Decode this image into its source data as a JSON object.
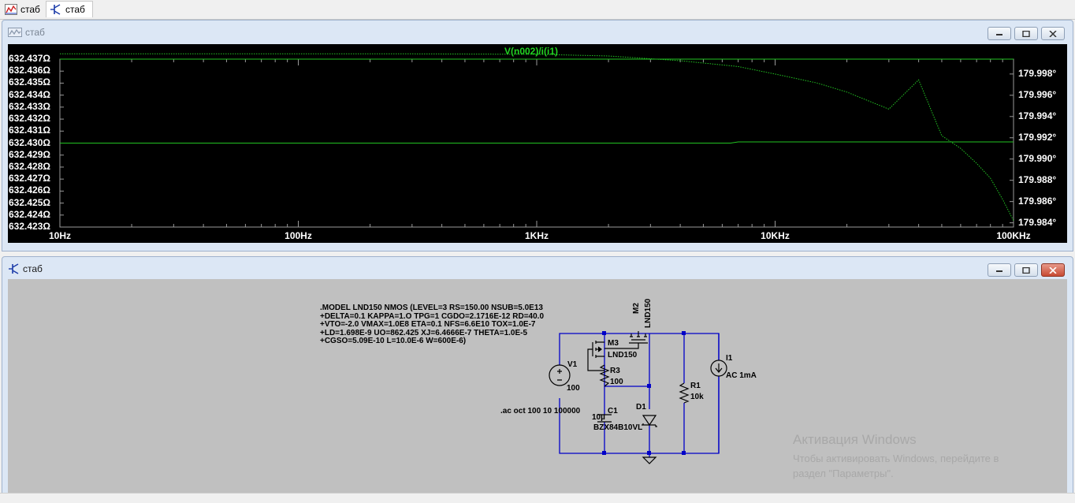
{
  "tabs": [
    {
      "label": "стаб",
      "icon": "waveform-icon"
    },
    {
      "label": "стаб",
      "icon": "schematic-icon"
    }
  ],
  "plot_window": {
    "title": "стаб"
  },
  "schematic_window": {
    "title": "стаб"
  },
  "chart_data": {
    "type": "line",
    "title": "V(n002)/i(i1)",
    "x_scale": "log",
    "xlim": [
      10,
      100000
    ],
    "x_ticks": [
      "10Hz",
      "100Hz",
      "1KHz",
      "10KHz",
      "100KHz"
    ],
    "left_ticks": [
      "632.437Ω",
      "632.436Ω",
      "632.435Ω",
      "632.434Ω",
      "632.433Ω",
      "632.432Ω",
      "632.431Ω",
      "632.430Ω",
      "632.429Ω",
      "632.428Ω",
      "632.427Ω",
      "632.426Ω",
      "632.425Ω",
      "632.424Ω",
      "632.423Ω"
    ],
    "left_ylim": [
      632.423,
      632.437
    ],
    "right_ticks": [
      "179.998°",
      "179.996°",
      "179.994°",
      "179.992°",
      "179.990°",
      "179.988°",
      "179.986°",
      "179.984°"
    ],
    "right_ylim": [
      179.9836,
      179.9994
    ],
    "grid": false,
    "series": [
      {
        "role": "magnitude",
        "axis": "left",
        "color": "#22c322",
        "x": [
          10,
          100,
          1000,
          10000,
          100000
        ],
        "y": [
          632.437,
          632.437,
          632.437,
          632.437,
          632.437
        ]
      },
      {
        "role": "magnitude-flat",
        "axis": "left",
        "color": "#22c322",
        "x": [
          10,
          100,
          1000,
          6500,
          7000,
          100000
        ],
        "y": [
          632.43,
          632.43,
          632.43,
          632.43,
          632.4301,
          632.4301
        ]
      },
      {
        "role": "phase",
        "axis": "right",
        "color": "#22c322",
        "dotted": true,
        "x": [
          10,
          300,
          1000,
          2000,
          4000,
          7000,
          10000,
          15000,
          20000,
          30000,
          40000,
          50000,
          60000,
          70000,
          80000,
          90000,
          100000
        ],
        "y": [
          179.9999,
          179.9999,
          179.99985,
          179.9997,
          179.99925,
          179.9987,
          179.998,
          179.99715,
          179.9963,
          179.9947,
          179.99745,
          179.9922,
          179.991,
          179.9896,
          179.9882,
          179.9862,
          179.9842
        ]
      }
    ]
  },
  "schematic": {
    "spice_lines": [
      ".MODEL LND150 NMOS (LEVEL=3 RS=150.00 NSUB=5.0E13",
      "+DELTA=0.1 KAPPA=1.O TPG=1 CGDO=2.1716E-12 RD=40.0",
      "+VTO=-2.0 VMAX=1.0E8 ETA=0.1 NFS=6.6E10 TOX=1.0E-7",
      "+LD=1.698E-9 UO=862.425 XJ=6.4666E-7 THETA=1.0E-5",
      "+CGSO=5.09E-10 L=10.0E-6 W=600E-6)"
    ],
    "directive": ".ac oct 100 10 100000",
    "m2": {
      "name": "M2",
      "model": "LND150"
    },
    "m3": {
      "name": "M3",
      "model": "LND150"
    },
    "r3": {
      "name": "R3",
      "value": "100"
    },
    "v1": {
      "name": "V1",
      "value": "100"
    },
    "c1": {
      "name": "C1",
      "value": "10µ"
    },
    "d1": {
      "name": "D1",
      "model": "BZX84B10VL"
    },
    "r1": {
      "name": "R1",
      "value": "10k"
    },
    "i1": {
      "name": "I1",
      "value": "AC 1mA"
    }
  },
  "watermark": {
    "title": "Активация Windows",
    "line1": "Чтобы активировать Windows, перейдите в",
    "line2": "раздел \"Параметры\"."
  }
}
